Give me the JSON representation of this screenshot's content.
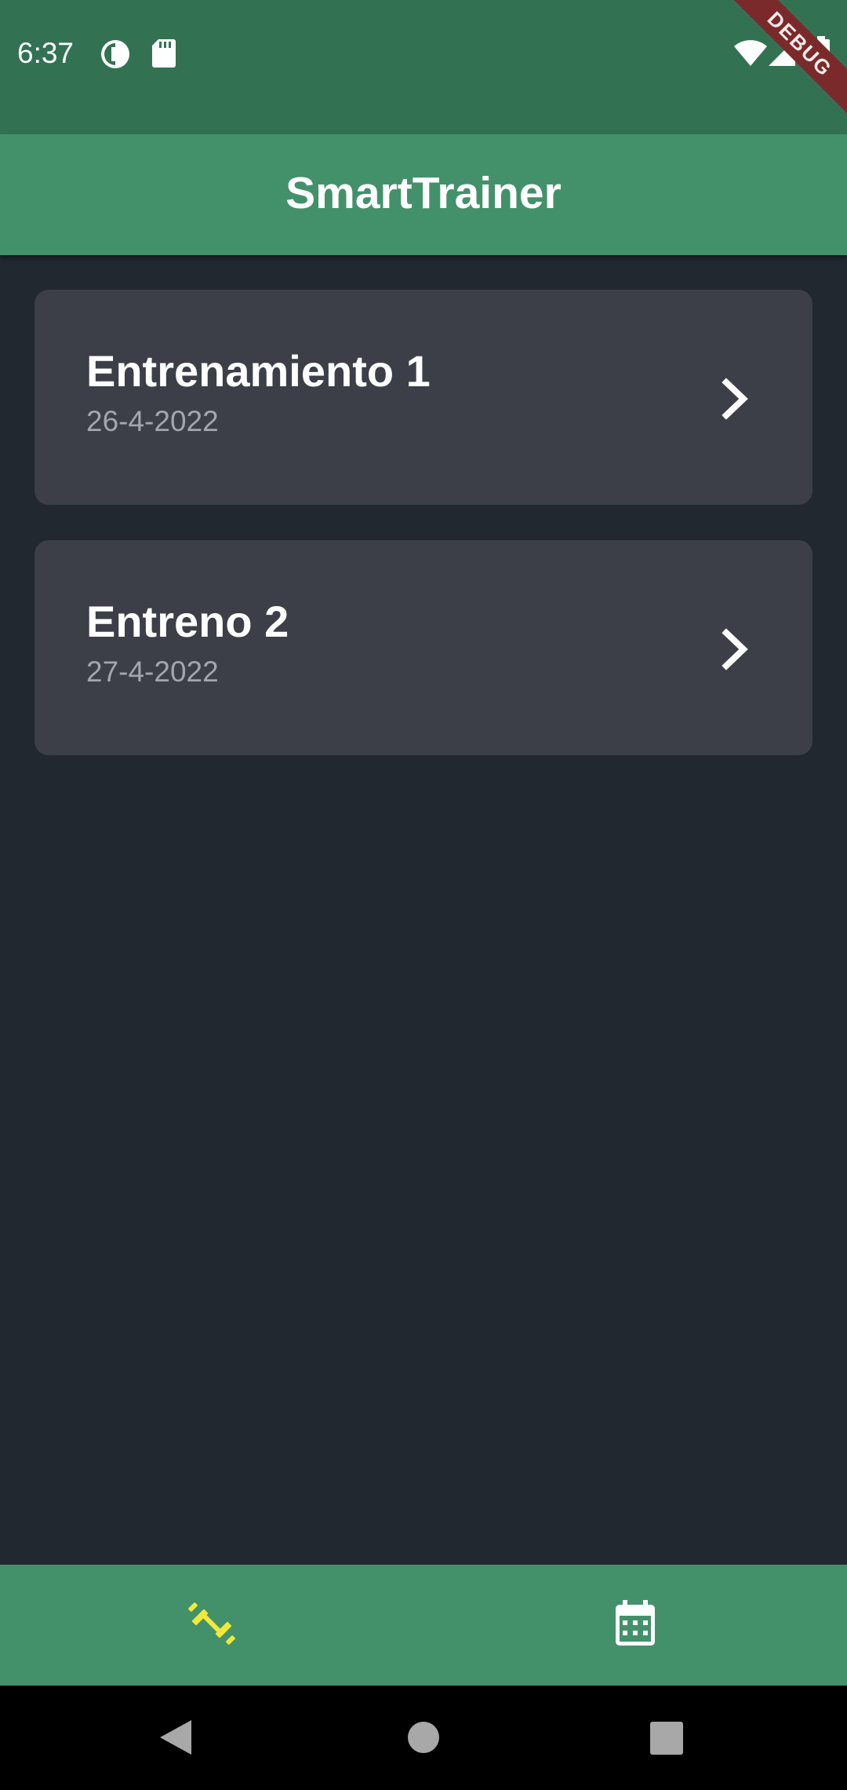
{
  "status_bar": {
    "time": "6:37",
    "left_icons": [
      "data-saver-icon",
      "sd-card-icon"
    ],
    "right_icons": [
      "wifi-icon",
      "signal-icon",
      "battery-icon"
    ],
    "debug_label": "DEBUG"
  },
  "app_bar": {
    "title": "SmartTrainer"
  },
  "trainings": [
    {
      "title": "Entrenamiento 1",
      "date": "26-4-2022"
    },
    {
      "title": "Entreno 2",
      "date": "27-4-2022"
    }
  ],
  "bottom_nav": {
    "items": [
      {
        "icon": "dumbbell-icon",
        "selected": true
      },
      {
        "icon": "calendar-icon",
        "selected": false
      }
    ]
  },
  "colors": {
    "status_bar": "#327252",
    "app_bar": "#43916b",
    "background": "#212830",
    "card": "#3c3f48",
    "selected_icon": "#f2e83b",
    "unselected_icon": "#ffffff",
    "date_text": "#a3a6ad"
  }
}
